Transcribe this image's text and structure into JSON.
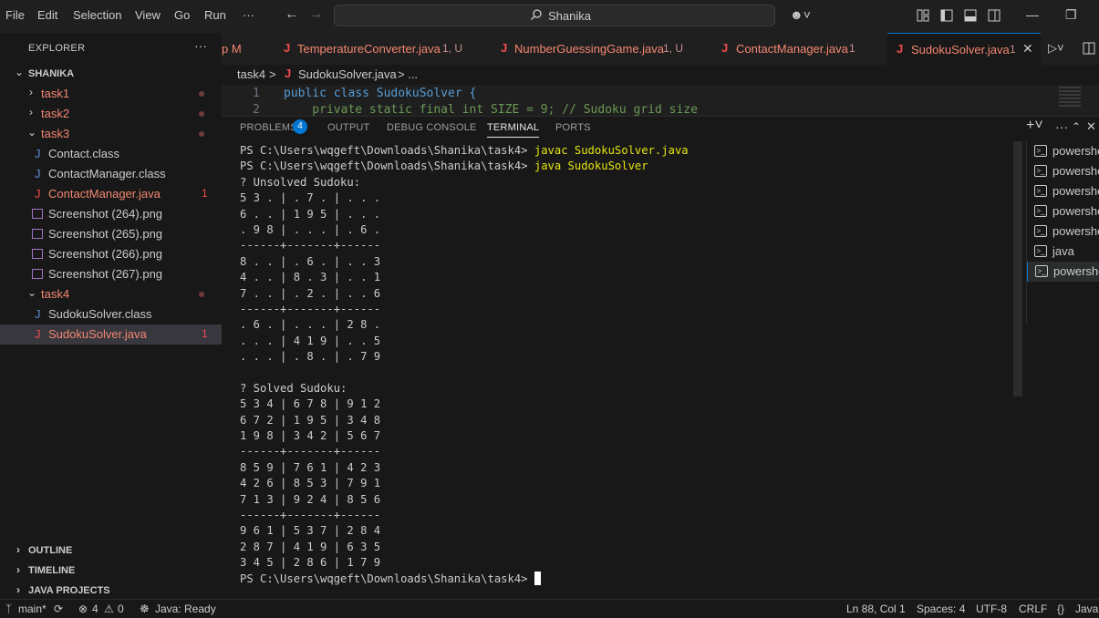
{
  "titlebar": {
    "menu": [
      "File",
      "Edit",
      "Selection",
      "View",
      "Go",
      "Run",
      "···"
    ],
    "search_label": "Shanika"
  },
  "sidebar": {
    "header": "EXPLORER",
    "more": "···",
    "root": "SHANIKA",
    "tree": [
      {
        "label": "task1",
        "kind": "folder",
        "open": false,
        "color": "#f48771"
      },
      {
        "label": "task2",
        "kind": "folder",
        "open": false,
        "color": "#f48771"
      },
      {
        "label": "task3",
        "kind": "folder",
        "open": true,
        "color": "#f48771"
      },
      {
        "label": "Contact.class",
        "kind": "class"
      },
      {
        "label": "ContactManager.class",
        "kind": "class"
      },
      {
        "label": "ContactManager.java",
        "kind": "java",
        "badge": "1"
      },
      {
        "label": "Screenshot (264).png",
        "kind": "png"
      },
      {
        "label": "Screenshot (265).png",
        "kind": "png"
      },
      {
        "label": "Screenshot (266).png",
        "kind": "png"
      },
      {
        "label": "Screenshot (267).png",
        "kind": "png"
      },
      {
        "label": "task4",
        "kind": "folder",
        "open": true,
        "color": "#f48771"
      },
      {
        "label": "SudokuSolver.class",
        "kind": "class"
      },
      {
        "label": "SudokuSolver.java",
        "kind": "java",
        "badge": "1",
        "selected": true
      }
    ],
    "sections": [
      "OUTLINE",
      "TIMELINE",
      "JAVA PROJECTS"
    ]
  },
  "tabs": [
    {
      "name": "p M",
      "meta": ""
    },
    {
      "name": "TemperatureConverter.java",
      "meta": "1, U"
    },
    {
      "name": "NumberGuessingGame.java",
      "meta": "1, U"
    },
    {
      "name": "ContactManager.java",
      "meta": "1"
    },
    {
      "name": "SudokuSolver.java",
      "meta": "1"
    }
  ],
  "breadcrumb": {
    "folder": "task4",
    "sep": ">",
    "file": "SudokuSolver.java",
    "tail": "> ..."
  },
  "editor": {
    "lines": [
      {
        "num": "1",
        "text": "public class SudokuSolver {"
      },
      {
        "num": "2",
        "text": "    private static final int SIZE = 9; // Sudoku grid size"
      }
    ]
  },
  "panel": {
    "tabs": [
      "PROBLEMS",
      "OUTPUT",
      "DEBUG CONSOLE",
      "TERMINAL",
      "PORTS"
    ],
    "problems_count": "4",
    "terminal_lines": [
      {
        "prompt": "PS C:\\Users\\wqgeft\\Downloads\\Shanika\\task4> ",
        "cmd": "javac SudokuSolver.java"
      },
      {
        "prompt": "PS C:\\Users\\wqgeft\\Downloads\\Shanika\\task4> ",
        "cmd": "java SudokuSolver"
      },
      {
        "prompt": "? Unsolved Sudoku:",
        "cmd": ""
      },
      {
        "prompt": "5 3 . | . 7 . | . . .",
        "cmd": ""
      },
      {
        "prompt": "6 . . | 1 9 5 | . . .",
        "cmd": ""
      },
      {
        "prompt": ". 9 8 | . . . | . 6 .",
        "cmd": ""
      },
      {
        "prompt": "------+-------+------",
        "cmd": ""
      },
      {
        "prompt": "8 . . | . 6 . | . . 3",
        "cmd": ""
      },
      {
        "prompt": "4 . . | 8 . 3 | . . 1",
        "cmd": ""
      },
      {
        "prompt": "7 . . | . 2 . | . . 6",
        "cmd": ""
      },
      {
        "prompt": "------+-------+------",
        "cmd": ""
      },
      {
        "prompt": ". 6 . | . . . | 2 8 .",
        "cmd": ""
      },
      {
        "prompt": ". . . | 4 1 9 | . . 5",
        "cmd": ""
      },
      {
        "prompt": ". . . | . 8 . | . 7 9",
        "cmd": ""
      },
      {
        "prompt": "",
        "cmd": ""
      },
      {
        "prompt": "? Solved Sudoku:",
        "cmd": ""
      },
      {
        "prompt": "5 3 4 | 6 7 8 | 9 1 2",
        "cmd": ""
      },
      {
        "prompt": "6 7 2 | 1 9 5 | 3 4 8",
        "cmd": ""
      },
      {
        "prompt": "1 9 8 | 3 4 2 | 5 6 7",
        "cmd": ""
      },
      {
        "prompt": "------+-------+------",
        "cmd": ""
      },
      {
        "prompt": "8 5 9 | 7 6 1 | 4 2 3",
        "cmd": ""
      },
      {
        "prompt": "4 2 6 | 8 5 3 | 7 9 1",
        "cmd": ""
      },
      {
        "prompt": "7 1 3 | 9 2 4 | 8 5 6",
        "cmd": ""
      },
      {
        "prompt": "------+-------+------",
        "cmd": ""
      },
      {
        "prompt": "9 6 1 | 5 3 7 | 2 8 4",
        "cmd": ""
      },
      {
        "prompt": "2 8 7 | 4 1 9 | 6 3 5",
        "cmd": ""
      },
      {
        "prompt": "3 4 5 | 2 8 6 | 1 7 9",
        "cmd": ""
      }
    ],
    "final_prompt": "PS C:\\Users\\wqgeft\\Downloads\\Shanika\\task4> ",
    "terminals": [
      "powershell",
      "powershell",
      "powershell",
      "powershell",
      "powershell",
      "java",
      "powershell"
    ]
  },
  "statusbar": {
    "branch": "main*",
    "errors": "4",
    "warnings": "0",
    "java": "Java: Ready",
    "position": "Ln 88, Col 1",
    "spaces": "Spaces: 4",
    "encoding": "UTF-8",
    "eol": "CRLF",
    "lang": "Java"
  },
  "colors": {
    "accent": "#0078d4",
    "error": "#f14c4c",
    "modified_file": "#f48771",
    "terminal_cmd": "#e5e510"
  }
}
